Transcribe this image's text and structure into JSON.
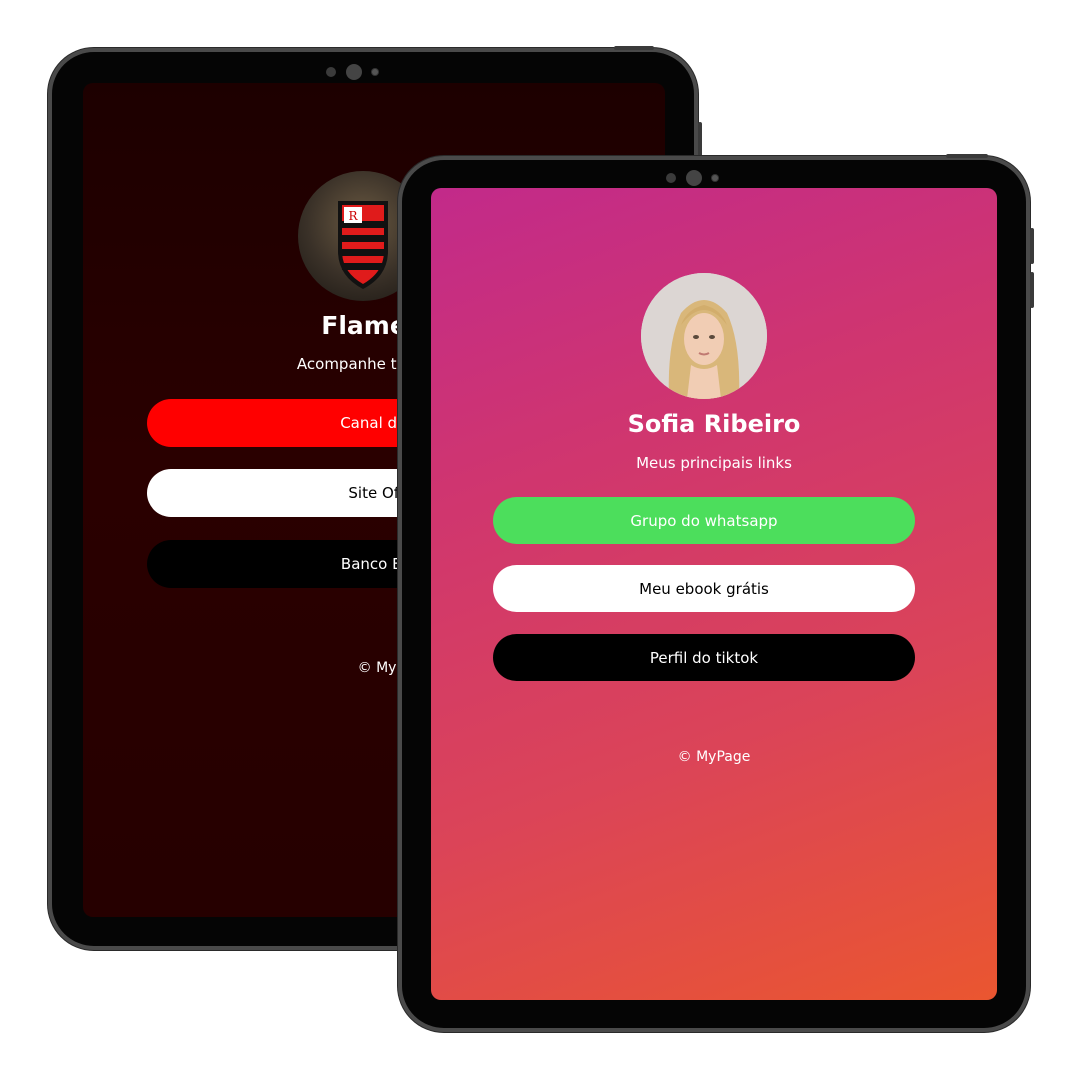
{
  "back_page": {
    "name": "Flamengo C",
    "subtitle": "Acompanhe tudo sobre",
    "links": [
      {
        "label": "Canal da Fl",
        "bg": "#ff0000",
        "fg": "#ffffff"
      },
      {
        "label": "Site Ofici",
        "bg": "#ffffff",
        "fg": "#000000"
      },
      {
        "label": "Banco BRB",
        "bg": "#000000",
        "fg": "#ffffff"
      }
    ],
    "footer": "© MyPage",
    "avatar_icon": "flamengo-crest-icon"
  },
  "front_page": {
    "name": "Sofia Ribeiro",
    "subtitle": "Meus principais links",
    "links": [
      {
        "label": "Grupo do whatsapp",
        "bg": "#4cde5c",
        "fg": "#ffffff"
      },
      {
        "label": "Meu ebook grátis",
        "bg": "#ffffff",
        "fg": "#000000"
      },
      {
        "label": "Perfil do tiktok",
        "bg": "#000000",
        "fg": "#ffffff"
      }
    ],
    "footer": "© MyPage",
    "avatar_icon": "profile-photo"
  }
}
